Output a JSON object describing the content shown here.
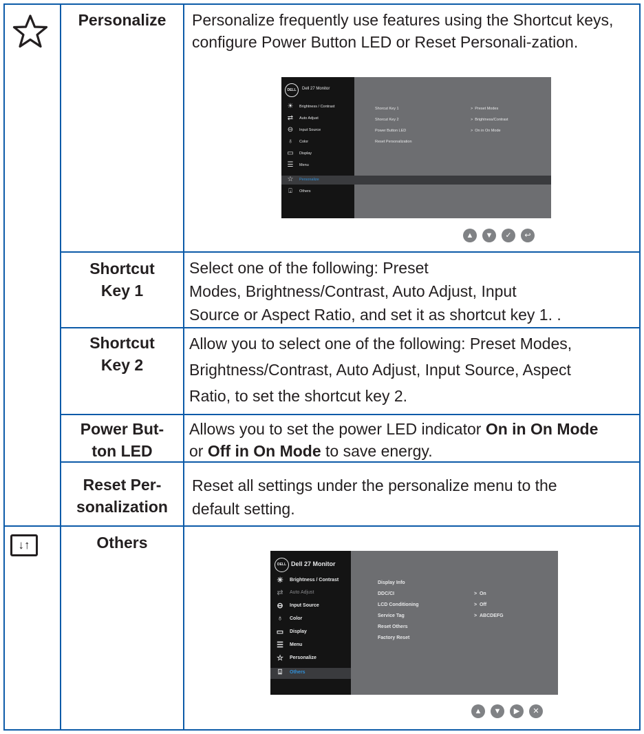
{
  "rows": {
    "personalize": {
      "title": "Personalize",
      "desc": "Personalize frequently use features using the Shortcut keys, configure Power Button LED or Reset Personali-zation.",
      "osd": {
        "brand": "DELL",
        "model": "Dell 27 Monitor",
        "menu": [
          "Brightness / Contrast",
          "Auto Adjust",
          "Input Source",
          "Color",
          "Display",
          "Menu",
          "Personalize",
          "Others"
        ],
        "items": [
          "Shorcut Key 1",
          "Shorcut Key 2",
          "Power Button LED",
          "Reset Personalization"
        ],
        "values": [
          "Preset Modes",
          "Brightness/Contrast",
          "On in On Mode"
        ]
      }
    },
    "shortcut1": {
      "title_a": "Shortcut",
      "title_b": "Key 1",
      "line1": "Select one of the following: Preset",
      "line2": "Modes, Brightness/Contrast, Auto Adjust, Input",
      "line3": "Source or Aspect Ratio, and set it as shortcut key 1. ."
    },
    "shortcut2": {
      "title_a": "Shortcut",
      "title_b": "Key 2",
      "line1": "Allow you to select one of the following: Preset Modes,",
      "line2": "Brightness/Contrast, Auto Adjust, Input Source, Aspect",
      "line3": "Ratio, to set the shortcut key 2."
    },
    "powerled": {
      "title_a": "Power But-",
      "title_b": "ton LED",
      "line1_pre": "Allows you to set the power LED indicator ",
      "line1_em": "On in On Mode",
      "line2_pre": "or ",
      "line2_em": "Off in On Mode",
      "line2_post": " to save energy."
    },
    "reset": {
      "title_a": "Reset Per-",
      "title_b": "sonalization",
      "line1": "Reset all settings under the personalize menu to the",
      "line2": "default setting."
    },
    "others": {
      "title": "Others",
      "icon_text": "↓↑",
      "osd": {
        "brand": "DELL",
        "model": "Dell 27 Monitor",
        "menu": [
          "Brightness / Contrast",
          "Auto Adjust",
          "Input Source",
          "Color",
          "Display",
          "Menu",
          "Personalize",
          "Others"
        ],
        "items": [
          "Display Info",
          "DDC/CI",
          "LCD Conditioning",
          "Service Tag",
          "Reset Others",
          "Factory Reset"
        ],
        "values": [
          "On",
          "Off",
          "ABCDEFG"
        ]
      }
    }
  }
}
